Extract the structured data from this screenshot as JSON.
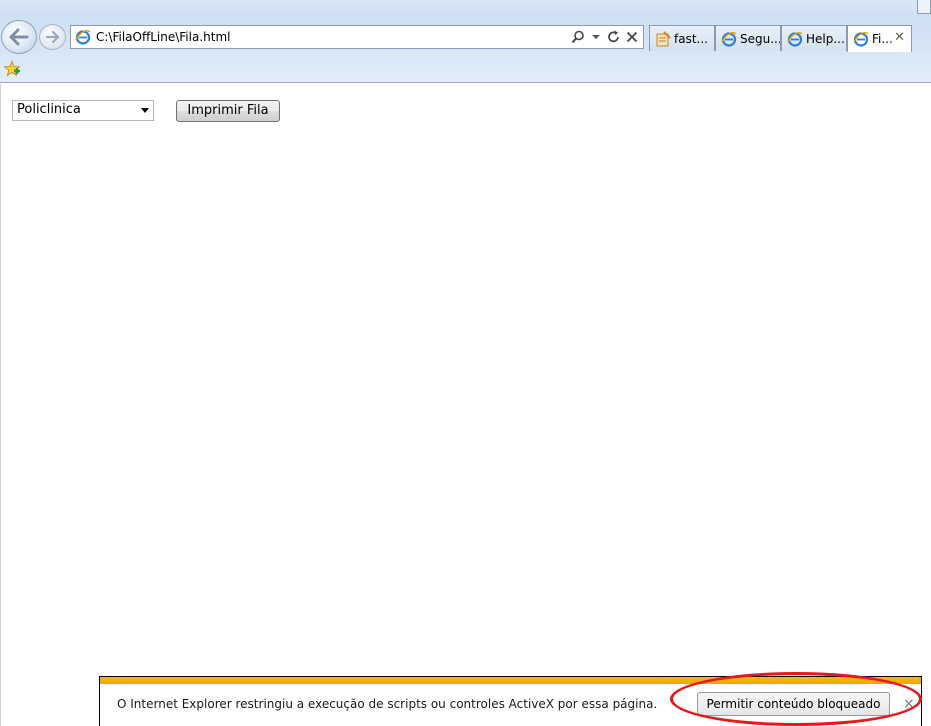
{
  "browser": {
    "address_url": "C:\\FilaOffLine\\Fila.html",
    "tabs": [
      {
        "label": "fast...",
        "icon": "notepad-icon",
        "active": false
      },
      {
        "label": "Segu...",
        "icon": "ie-icon",
        "active": false
      },
      {
        "label": "Help...",
        "icon": "ie-icon",
        "active": false
      },
      {
        "label": "Fi...",
        "icon": "ie-icon",
        "active": true
      }
    ]
  },
  "page": {
    "select_value": "Policlinica",
    "print_button": "Imprimir Fila"
  },
  "notification": {
    "message": "O Internet Explorer restringiu a execução de scripts ou controles ActiveX por essa página.",
    "allow_button": "Permitir conteúdo bloqueado",
    "close": "×",
    "accent": "#f5b800",
    "highlight": "#e3191e"
  }
}
